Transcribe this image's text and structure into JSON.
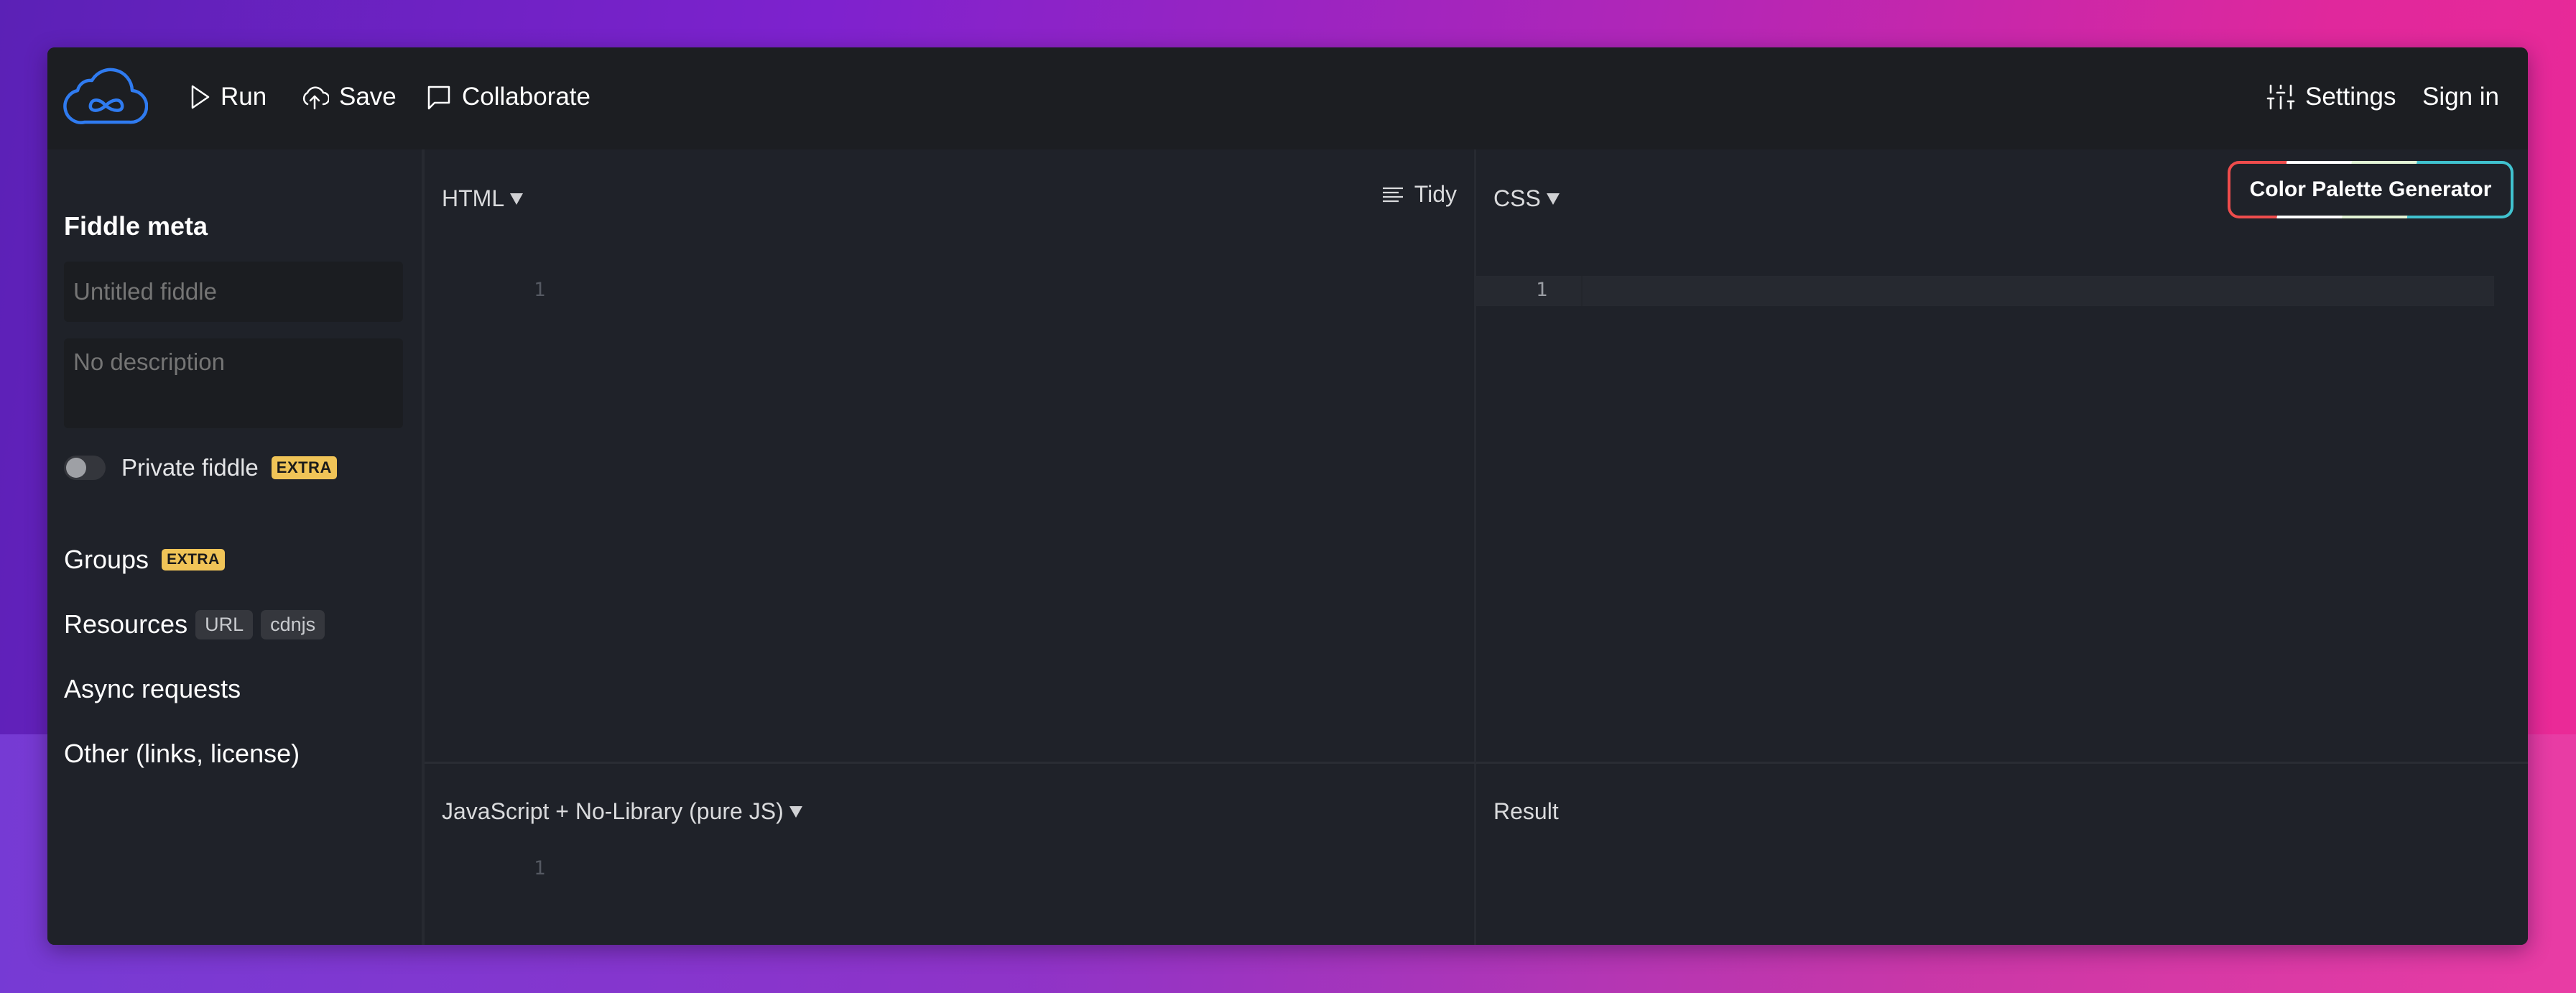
{
  "header": {
    "logo": "jsfiddle-cloud-infinity-logo",
    "run_label": "Run",
    "save_label": "Save",
    "collaborate_label": "Collaborate",
    "settings_label": "Settings",
    "signin_label": "Sign in"
  },
  "sidebar": {
    "title": "Fiddle meta",
    "title_placeholder": "Untitled fiddle",
    "description_placeholder": "No description",
    "private_label": "Private fiddle",
    "private_enabled": false,
    "extra_badge": "EXTRA",
    "items": [
      {
        "label": "Groups",
        "badge": "EXTRA"
      },
      {
        "label": "Resources",
        "tags": [
          "URL",
          "cdnjs"
        ]
      },
      {
        "label": "Async requests"
      },
      {
        "label": "Other (links, license)"
      }
    ]
  },
  "panels": {
    "html": {
      "label": "HTML",
      "tidy_label": "Tidy",
      "line_number": "1"
    },
    "css": {
      "label": "CSS",
      "line_number": "1"
    },
    "js": {
      "label": "JavaScript + No-Library (pure JS)",
      "line_number": "1"
    },
    "result": {
      "label": "Result"
    }
  },
  "extension_button": {
    "label": "Color Palette Generator",
    "colors": [
      "#ef4c4c",
      "#ffffff",
      "#e3f4d6",
      "#40c2cf"
    ]
  },
  "colors": {
    "brand_blue": "#2f7bf0",
    "extra_badge": "#f0c457"
  }
}
